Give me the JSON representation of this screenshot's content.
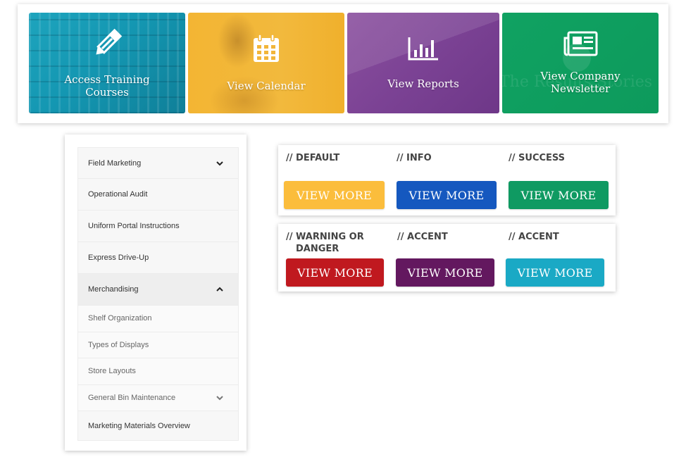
{
  "tiles": [
    {
      "label": "Access Training Courses",
      "icon": "pencil-icon",
      "color": "#1a9db8"
    },
    {
      "label": "View Calendar",
      "icon": "calendar-icon",
      "color": "#f2b63a"
    },
    {
      "label": "View Reports",
      "icon": "bar-chart-icon",
      "color": "#7b4294"
    },
    {
      "label": "View Company Newsletter",
      "icon": "newspaper-icon",
      "color": "#10a262",
      "watermark": "The Results Stories"
    }
  ],
  "sidebar": {
    "items": [
      {
        "label": "Field Marketing",
        "chevron": "down"
      },
      {
        "label": "Operational Audit"
      },
      {
        "label": "Uniform Portal Instructions"
      },
      {
        "label": "Express Drive-Up"
      },
      {
        "label": "Merchandising",
        "chevron": "up",
        "expanded": true
      },
      {
        "label": "Shelf Organization"
      },
      {
        "label": "Types of Displays"
      },
      {
        "label": "Store Layouts"
      },
      {
        "label": "General Bin Maintenance",
        "chevron": "down"
      },
      {
        "label": "Marketing Materials Overview"
      }
    ]
  },
  "buttons": {
    "row1": [
      {
        "heading": "// DEFAULT",
        "label": "VIEW MORE",
        "color": "#fbbd3c"
      },
      {
        "heading": "// INFO",
        "label": "VIEW MORE",
        "color": "#1558bf"
      },
      {
        "heading": "// SUCCESS",
        "label": "VIEW MORE",
        "color": "#0f9a62"
      }
    ],
    "row2": [
      {
        "heading": "// WARNING OR",
        "heading2": "DANGER",
        "label": "VIEW MORE",
        "color": "#c0191f"
      },
      {
        "heading": "// ACCENT",
        "label": "VIEW MORE",
        "color": "#63185f"
      },
      {
        "heading": "// ACCENT",
        "label": "VIEW MORE",
        "color": "#1aa9c5"
      }
    ]
  }
}
